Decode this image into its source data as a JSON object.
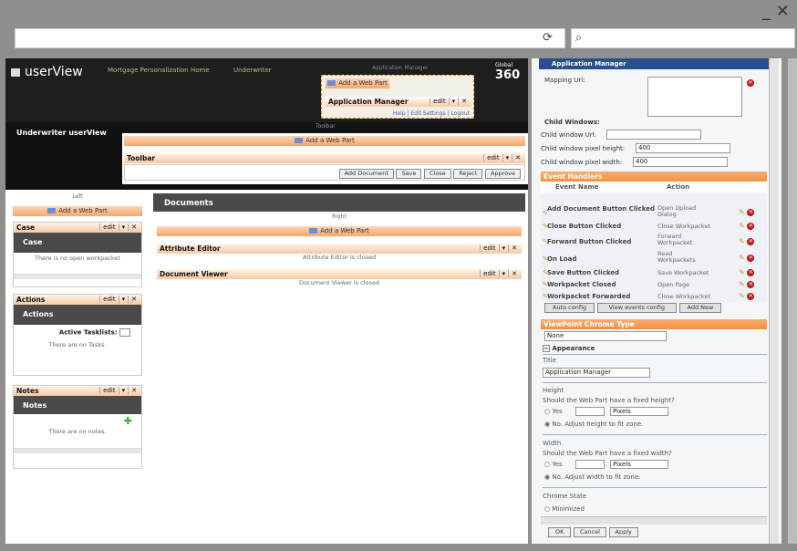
{
  "window": {
    "minimize": "_",
    "close": "✕"
  },
  "browser": {
    "refresh_icon": "refresh-icon",
    "search_icon": "search-icon"
  },
  "header": {
    "title": "userView",
    "nav": [
      "Mortgage Personalization Home",
      "Underwriter"
    ],
    "app_manager_label": "Application Manager",
    "brand": "360",
    "brand_small": "Global"
  },
  "app_manager_zone": {
    "add_web_part": "Add a Web Part",
    "title": "Application Manager",
    "edit": "edit",
    "menu_arrow": "▾",
    "close": "✕",
    "links": "Help | Edit Settings | Logout"
  },
  "toolbar_zone": {
    "label": "Toolbar",
    "section_title": "Underwriter userView",
    "add_web_part": "Add a Web Part",
    "part_title": "Toolbar",
    "edit": "edit",
    "buttons": [
      "Add Document",
      "Save",
      "Close",
      "Reject",
      "Approve"
    ]
  },
  "left_zone": {
    "label": "Left",
    "add_web_part": "Add a Web Part",
    "case": {
      "title": "Case",
      "header": "Case",
      "edit": "edit",
      "message": "There is no open workpacket"
    },
    "actions": {
      "title": "Actions",
      "header": "Actions",
      "edit": "edit",
      "tasklists_label": "Active Tasklists:",
      "message": "There are no Tasks."
    },
    "notes": {
      "title": "Notes",
      "header": "Notes",
      "edit": "edit",
      "add": "✚",
      "message": "There are no notes."
    }
  },
  "documents": {
    "title": "Documents",
    "right_label": "Right",
    "add_web_part": "Add a Web Part",
    "attribute_editor": {
      "title": "Attribute Editor",
      "edit": "edit",
      "message": "Attribute Editor is closed"
    },
    "document_viewer": {
      "title": "Document Viewer",
      "edit": "edit",
      "message": "Document Viewer is closed"
    }
  },
  "settings": {
    "title": "Application Manager",
    "mapping_url": "Mapping Url:",
    "child_windows": "Child Windows:",
    "child_url": "Child window Url:",
    "child_height": "Child window pixel height:",
    "child_height_value": "400",
    "child_width": "Child window pixel width:",
    "child_width_value": "400",
    "event_handlers": "Event Handlers",
    "event_name_col": "Event Name",
    "action_col": "Action",
    "events": [
      {
        "name": "Add Document Button Clicked",
        "action": "Open Upload Dialog"
      },
      {
        "name": "Close Button Clicked",
        "action": "Close Workpacket"
      },
      {
        "name": "Forward Button Clicked",
        "action": "Forward Workpacket"
      },
      {
        "name": "On Load",
        "action": "Read Workpackets"
      },
      {
        "name": "Save Button Clicked",
        "action": "Save Workpacket"
      },
      {
        "name": "Workpacket Closed",
        "action": "Open Page"
      },
      {
        "name": "Workpacket Forwarded",
        "action": "Close Workpacket"
      }
    ],
    "auto_config": "Auto config",
    "view_events": "View events config",
    "add_new": "Add New",
    "chrome_type": "ViewPoint Chrome Type",
    "chrome_value": "None",
    "appearance": "Appearance",
    "appearance_toggle": "−",
    "title_label": "Title",
    "title_value": "Application Manager",
    "height_label": "Height",
    "height_q": "Should the Web Part have a fixed height?",
    "yes": "Yes",
    "pixels": "Pixels",
    "height_no": "No. Adjust height to fit zone.",
    "width_label": "Width",
    "width_q": "Should the Web Part have a fixed width?",
    "width_no": "No. Adjust width to fit zone.",
    "chrome_state": "Chrome State",
    "minimized": "Minimized",
    "ok": "OK",
    "cancel": "Cancel",
    "apply": "Apply"
  }
}
